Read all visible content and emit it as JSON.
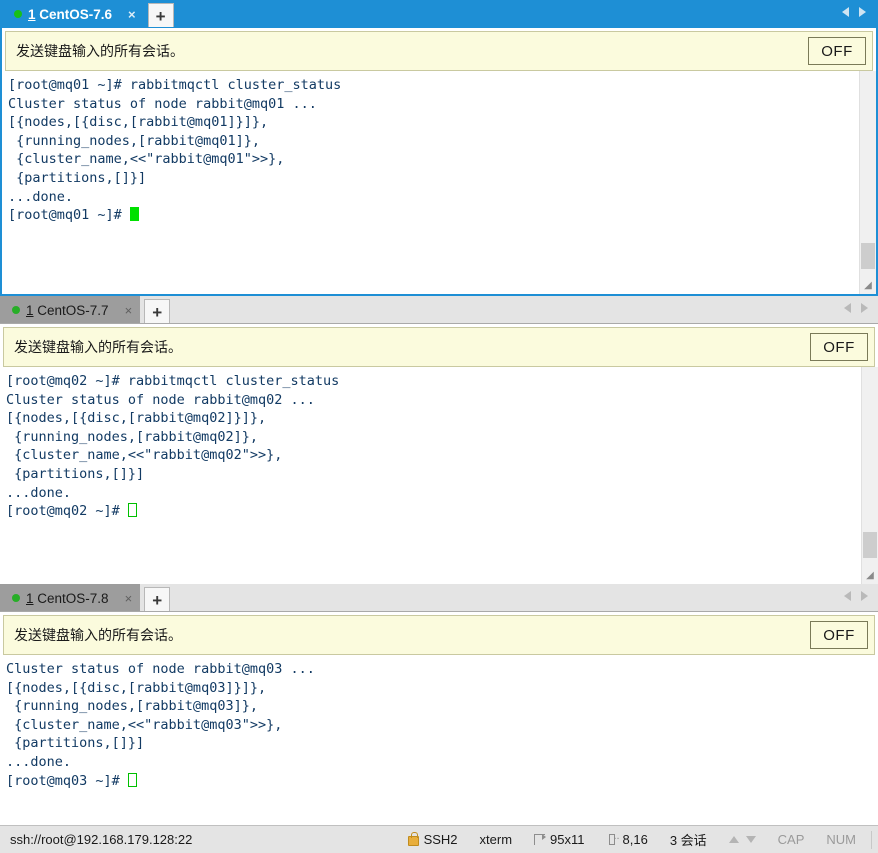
{
  "window": {
    "accent_color": "#1e8fd5",
    "terminal_text_color": "#123a63",
    "broadcast_bar_color": "#fbfbdd"
  },
  "panes": [
    {
      "focused": true,
      "tab": {
        "mnemonic": "1",
        "label": " CentOS-7.6",
        "close_label": "×",
        "status_dot": "connected-dot"
      },
      "new_tab_label": "+",
      "nav_prev": "prev-tab-arrow",
      "nav_next": "next-tab-arrow",
      "broadcast": {
        "text": "发送键盘输入的所有会话。",
        "toggle_label": "OFF"
      },
      "terminal": {
        "lines": [
          "[root@mq01 ~]# rabbitmqctl cluster_status",
          "Cluster status of node rabbit@mq01 ...",
          "[{nodes,[{disc,[rabbit@mq01]}]},",
          " {running_nodes,[rabbit@mq01]},",
          " {cluster_name,<<\"rabbit@mq01\">>},",
          " {partitions,[]}]",
          "...done.",
          "[root@mq01 ~]# "
        ],
        "cursor": "filled"
      }
    },
    {
      "focused": false,
      "tab": {
        "mnemonic": "1",
        "label": " CentOS-7.7",
        "close_label": "×",
        "status_dot": "connected-dot"
      },
      "new_tab_label": "+",
      "nav_prev": "prev-tab-arrow",
      "nav_next": "next-tab-arrow",
      "broadcast": {
        "text": "发送键盘输入的所有会话。",
        "toggle_label": "OFF"
      },
      "terminal": {
        "lines": [
          "[root@mq02 ~]# rabbitmqctl cluster_status",
          "Cluster status of node rabbit@mq02 ...",
          "[{nodes,[{disc,[rabbit@mq02]}]},",
          " {running_nodes,[rabbit@mq02]},",
          " {cluster_name,<<\"rabbit@mq02\">>},",
          " {partitions,[]}]",
          "...done.",
          "[root@mq02 ~]# "
        ],
        "cursor": "hollow"
      }
    },
    {
      "focused": false,
      "tab": {
        "mnemonic": "1",
        "label": " CentOS-7.8",
        "close_label": "×",
        "status_dot": "connected-dot"
      },
      "new_tab_label": "+",
      "nav_prev": "prev-tab-arrow",
      "nav_next": "next-tab-arrow",
      "broadcast": {
        "text": "发送键盘输入的所有会话。",
        "toggle_label": "OFF"
      },
      "terminal": {
        "lines": [
          "Cluster status of node rabbit@mq03 ...",
          "[{nodes,[{disc,[rabbit@mq03]}]},",
          " {running_nodes,[rabbit@mq03]},",
          " {cluster_name,<<\"rabbit@mq03\">>},",
          " {partitions,[]}]",
          "...done.",
          "[root@mq03 ~]# "
        ],
        "cursor": "hollow"
      }
    }
  ],
  "statusbar": {
    "connection": "ssh://root@192.168.179.128:22",
    "protocol": "SSH2",
    "term_type": "xterm",
    "window_size": "95x11",
    "cursor_position": "8,16",
    "session_count": "3 会话",
    "cap_label": "CAP",
    "num_label": "NUM"
  }
}
